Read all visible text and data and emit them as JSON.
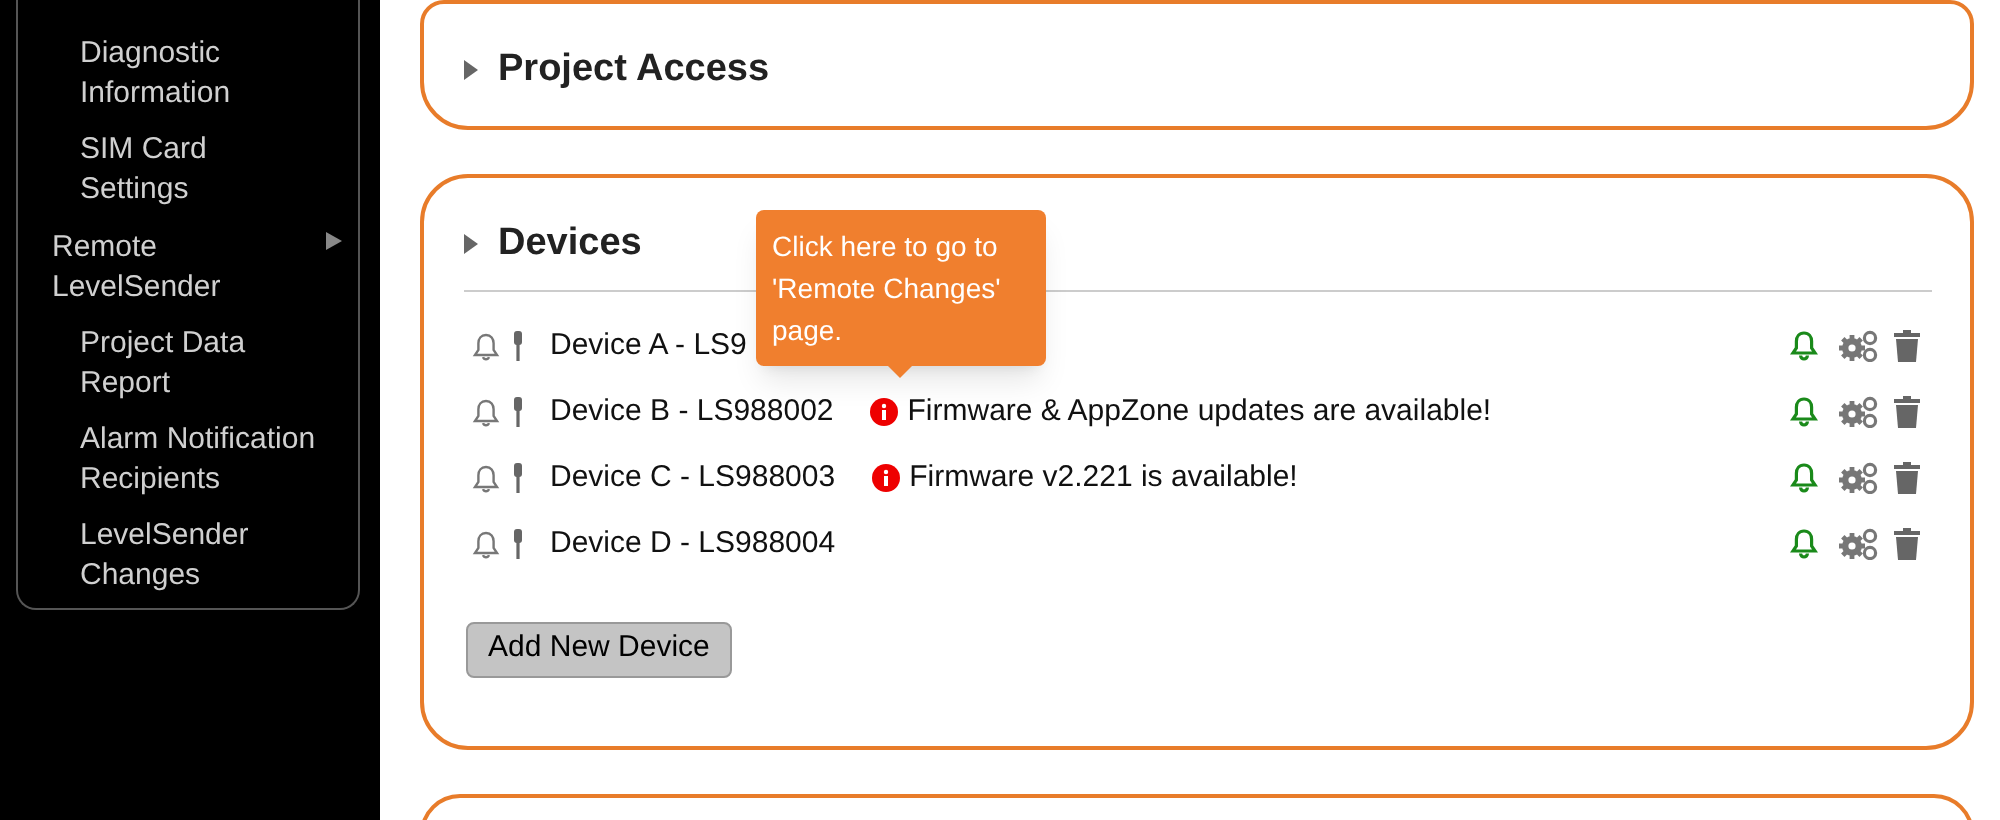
{
  "sidebar": {
    "items": [
      {
        "children": [
          {
            "label": "Diagnostic Information"
          },
          {
            "label": "SIM Card Settings"
          }
        ]
      },
      {
        "label": "Remote LevelSender",
        "has_submenu": true,
        "children": [
          {
            "label": "Project Data Report"
          },
          {
            "label": "Alarm Notification Recipients"
          },
          {
            "label": "LevelSender Changes"
          }
        ]
      }
    ]
  },
  "sections": [
    {
      "title": "Project Access",
      "expanded": false
    },
    {
      "title": "Devices",
      "expanded": false
    }
  ],
  "devices": [
    {
      "name": "Device A - LS9"
    },
    {
      "name": "Device B - LS988002",
      "notice": "Firmware & AppZone updates are available!"
    },
    {
      "name": "Device C - LS988003",
      "notice": "Firmware v2.221 is available!"
    },
    {
      "name": "Device D - LS988004"
    }
  ],
  "tooltip": "Click here to go to 'Remote Changes' page.",
  "add_button": "Add New Device"
}
